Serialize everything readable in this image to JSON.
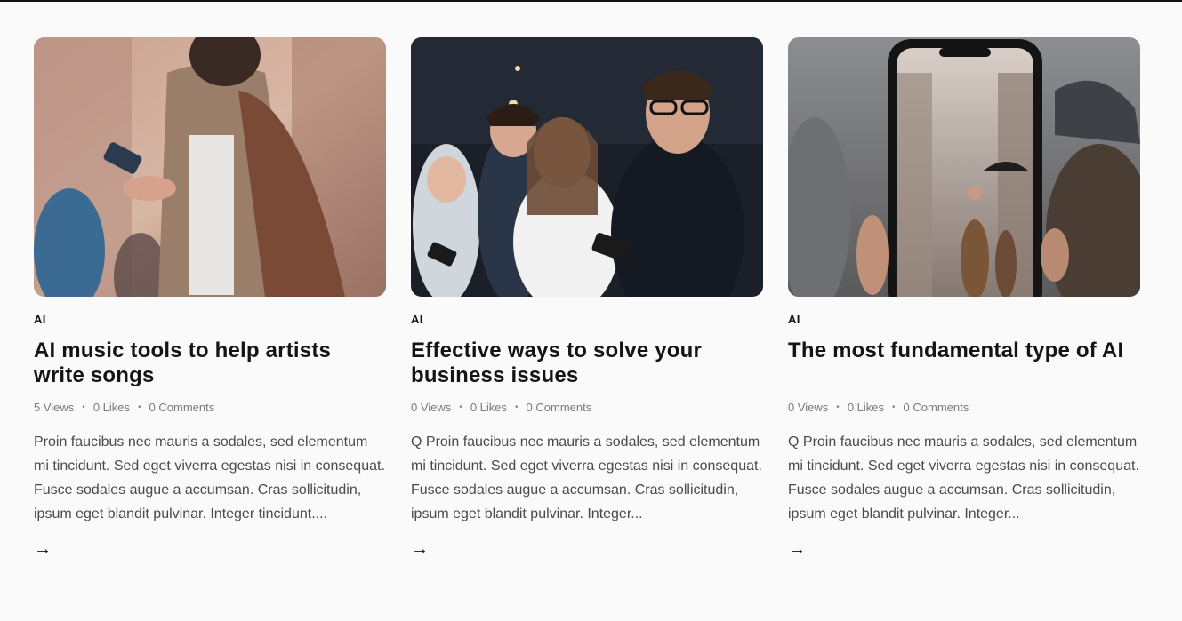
{
  "posts": [
    {
      "category": "AI",
      "title": "AI music tools to help artists write songs",
      "views": "5 Views",
      "likes": "0 Likes",
      "comments": "0 Comments",
      "excerpt": "Proin faucibus nec mauris a sodales, sed elementum mi tincidunt. Sed eget viverra egestas nisi in consequat. Fusce sodales augue a accumsan. Cras sollicitudin, ipsum eget blandit pulvinar. Integer tincidunt....",
      "arrow": "→"
    },
    {
      "category": "AI",
      "title": "Effective ways to solve your business issues",
      "views": "0 Views",
      "likes": "0 Likes",
      "comments": "0 Comments",
      "excerpt": "Q Proin faucibus nec mauris a sodales, sed elementum mi tincidunt. Sed eget viverra egestas nisi in consequat. Fusce sodales augue a accumsan. Cras sollicitudin, ipsum eget blandit pulvinar. Integer...",
      "arrow": "→"
    },
    {
      "category": "AI",
      "title": "The most fundamental type of AI",
      "views": "0 Views",
      "likes": "0 Likes",
      "comments": "0 Comments",
      "excerpt": "Q Proin faucibus nec mauris a sodales, sed elementum mi tincidunt. Sed eget viverra egestas nisi in consequat. Fusce sodales augue a accumsan. Cras sollicitudin, ipsum eget blandit pulvinar. Integer...",
      "arrow": "→"
    }
  ],
  "meta_separator": "•",
  "colors": {
    "background": "#fafafa",
    "title": "#141414",
    "meta": "#7a7a7a",
    "excerpt": "#4a4a4a"
  }
}
